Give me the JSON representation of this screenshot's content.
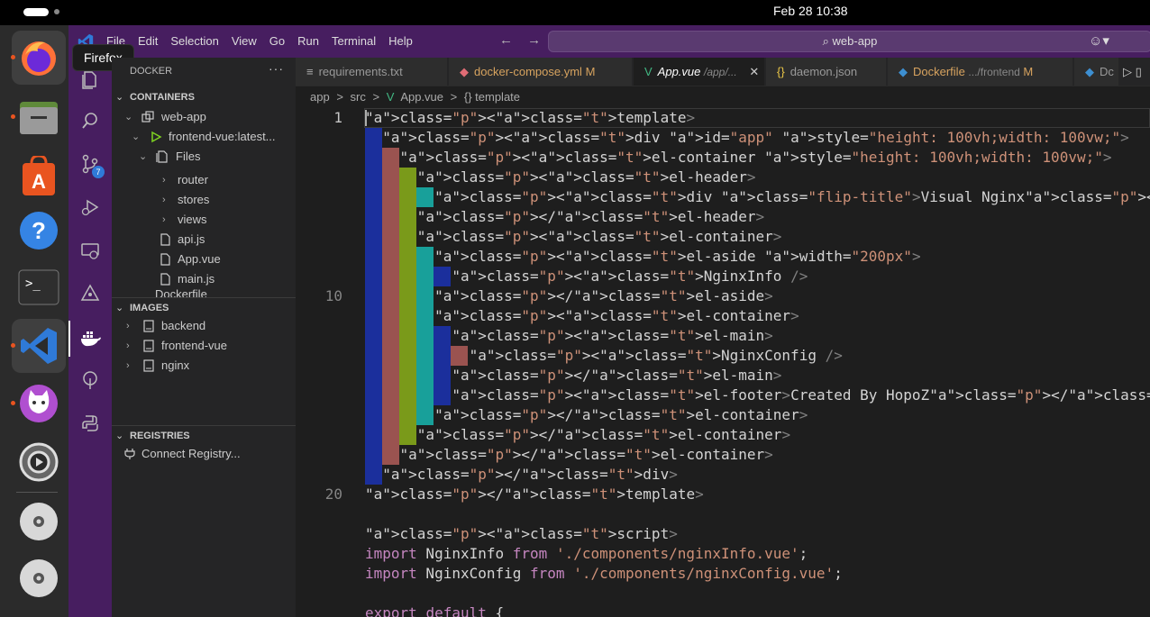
{
  "system": {
    "clock": "Feb 28  10:38"
  },
  "dock": {
    "tooltip": "Firefox",
    "apps": [
      {
        "name": "firefox-icon"
      },
      {
        "name": "files-icon"
      },
      {
        "name": "app-center-icon"
      },
      {
        "name": "help-icon"
      },
      {
        "name": "terminal-icon"
      },
      {
        "name": "vscode-icon"
      },
      {
        "name": "cat-app-icon"
      },
      {
        "name": "settings-icon"
      },
      {
        "name": "disc-icon"
      },
      {
        "name": "disc-icon"
      }
    ]
  },
  "titlebar": {
    "menu": [
      "File",
      "Edit",
      "Selection",
      "View",
      "Go",
      "Run",
      "Terminal",
      "Help"
    ],
    "search": "web-app"
  },
  "activity": {
    "scm_badge": "7"
  },
  "sidebar": {
    "title": "DOCKER",
    "containers_label": "CONTAINERS",
    "container": "web-app",
    "service": "frontend-vue:latest...",
    "files": "Files",
    "items": [
      "router",
      "stores",
      "views",
      "api.js",
      "App.vue",
      "main.js",
      "Dockerfile"
    ],
    "images_label": "IMAGES",
    "images": [
      "backend",
      "frontend-vue",
      "nginx"
    ],
    "registries_label": "REGISTRIES",
    "connect": "Connect Registry..."
  },
  "tabs": [
    {
      "label": "requirements.txt",
      "path": "",
      "mod": ""
    },
    {
      "label": "docker-compose.yml",
      "path": "",
      "mod": "M"
    },
    {
      "label": "App.vue",
      "path": "/app/...",
      "mod": ""
    },
    {
      "label": "daemon.json",
      "path": "",
      "mod": ""
    },
    {
      "label": "Dockerfile",
      "path": ".../frontend",
      "mod": "M"
    },
    {
      "label": "Dc",
      "path": "",
      "mod": ""
    }
  ],
  "breadcrumb": [
    "app",
    ">",
    "src",
    ">",
    "App.vue",
    ">",
    "{} template"
  ],
  "line_numbers": [
    "1",
    "10",
    "20"
  ],
  "code": [
    "<template>",
    "  <div id=\"app\" style=\"height: 100vh;width: 100vw;\">",
    "    <el-container style=\"height: 100vh;width: 100vw;\">",
    "      <el-header>",
    "        <div class=\"flip-title\">Visual Nginx</div>",
    "      </el-header>",
    "      <el-container>",
    "        <el-aside width=\"200px\">",
    "          <NginxInfo />",
    "        </el-aside>",
    "        <el-container>",
    "          <el-main>",
    "            <NginxConfig />",
    "          </el-main>",
    "          <el-footer>Created By HopoZ</el-footer>",
    "        </el-container>",
    "      </el-container>",
    "    </el-container>",
    "  </div>",
    "</template>",
    "",
    "<script>",
    "import NginxInfo from './components/nginxInfo.vue';",
    "import NginxConfig from './components/nginxConfig.vue';",
    "",
    "export default {"
  ],
  "colors": {
    "rainbow1": "#1b2f9c",
    "rainbow2": "#9a5350",
    "rainbow3": "#7a9a1a",
    "rainbow4": "#18a09a",
    "rainbow5": "#1b2f9c",
    "rainbow6": "#9a5350"
  }
}
